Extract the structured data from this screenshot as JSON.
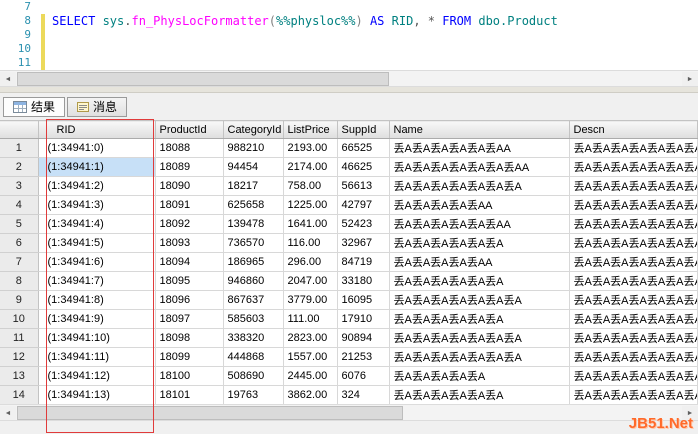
{
  "editor": {
    "line_numbers": [
      "7",
      "8",
      "9",
      "10",
      "11"
    ],
    "sql_tokens": [
      {
        "text": "SELECT ",
        "color": "#0000ff"
      },
      {
        "text": "sys",
        "color": "#008080"
      },
      {
        "text": ".",
        "color": "#555555"
      },
      {
        "text": "fn_PhysLocFormatter",
        "color": "#ff00ff"
      },
      {
        "text": "(",
        "color": "#808080"
      },
      {
        "text": "%%physloc%%",
        "color": "#008080"
      },
      {
        "text": ") ",
        "color": "#808080"
      },
      {
        "text": "AS",
        "color": "#0000ff"
      },
      {
        "text": " RID",
        "color": "#008080"
      },
      {
        "text": ", * ",
        "color": "#555555"
      },
      {
        "text": "FROM",
        "color": "#0000ff"
      },
      {
        "text": " dbo.Product",
        "color": "#008080"
      }
    ]
  },
  "tabs": {
    "results": "结果",
    "messages": "消息"
  },
  "grid": {
    "columns": [
      "RID",
      "ProductId",
      "CategoryId",
      "ListPrice",
      "SuppId",
      "Name",
      "Descn"
    ],
    "rows": [
      {
        "num": "1",
        "rid": "(1:34941:0)",
        "product_id": "18088",
        "category_id": "988210",
        "list_price": "2193.00",
        "supp_id": "66525",
        "name": "丢A丢A丢A丢A丢A丢AA",
        "descn": "丢A丢A丢A丢A丢A丢A丢A丢A丢A",
        "selected": false
      },
      {
        "num": "2",
        "rid": "(1:34941:1)",
        "product_id": "18089",
        "category_id": "94454",
        "list_price": "2174.00",
        "supp_id": "46625",
        "name": "丢A丢A丢A丢A丢A丢A丢AA",
        "descn": "丢A丢A丢A丢A丢A丢A丢A丢A丢A",
        "selected": true
      },
      {
        "num": "3",
        "rid": "(1:34941:2)",
        "product_id": "18090",
        "category_id": "18217",
        "list_price": "758.00",
        "supp_id": "56613",
        "name": "丢A丢A丢A丢A丢A丢A丢A",
        "descn": "丢A丢A丢A丢A丢A丢A丢A丢A丢A",
        "selected": false
      },
      {
        "num": "4",
        "rid": "(1:34941:3)",
        "product_id": "18091",
        "category_id": "625658",
        "list_price": "1225.00",
        "supp_id": "42797",
        "name": "丢A丢A丢A丢A丢AA",
        "descn": "丢A丢A丢A丢A丢A丢A丢A丢A丢A",
        "selected": false
      },
      {
        "num": "5",
        "rid": "(1:34941:4)",
        "product_id": "18092",
        "category_id": "139478",
        "list_price": "1641.00",
        "supp_id": "52423",
        "name": "丢A丢A丢A丢A丢A丢AA",
        "descn": "丢A丢A丢A丢A丢A丢A丢A丢A丢A",
        "selected": false
      },
      {
        "num": "6",
        "rid": "(1:34941:5)",
        "product_id": "18093",
        "category_id": "736570",
        "list_price": "116.00",
        "supp_id": "32967",
        "name": "丢A丢A丢A丢A丢A丢A",
        "descn": "丢A丢A丢A丢A丢A丢A丢A丢A丢A",
        "selected": false
      },
      {
        "num": "7",
        "rid": "(1:34941:6)",
        "product_id": "18094",
        "category_id": "186965",
        "list_price": "296.00",
        "supp_id": "84719",
        "name": "丢A丢A丢A丢A丢AA",
        "descn": "丢A丢A丢A丢A丢A丢A丢A丢A丢A",
        "selected": false
      },
      {
        "num": "8",
        "rid": "(1:34941:7)",
        "product_id": "18095",
        "category_id": "946860",
        "list_price": "2047.00",
        "supp_id": "33180",
        "name": "丢A丢A丢A丢A丢A丢A",
        "descn": "丢A丢A丢A丢A丢A丢A丢A丢A丢A",
        "selected": false
      },
      {
        "num": "9",
        "rid": "(1:34941:8)",
        "product_id": "18096",
        "category_id": "867637",
        "list_price": "3779.00",
        "supp_id": "16095",
        "name": "丢A丢A丢A丢A丢A丢A丢A",
        "descn": "丢A丢A丢A丢A丢A丢A丢A丢A丢A",
        "selected": false
      },
      {
        "num": "10",
        "rid": "(1:34941:9)",
        "product_id": "18097",
        "category_id": "585603",
        "list_price": "111.00",
        "supp_id": "17910",
        "name": "丢A丢A丢A丢A丢A丢A",
        "descn": "丢A丢A丢A丢A丢A丢A丢A丢A丢A",
        "selected": false
      },
      {
        "num": "11",
        "rid": "(1:34941:10)",
        "product_id": "18098",
        "category_id": "338320",
        "list_price": "2823.00",
        "supp_id": "90894",
        "name": "丢A丢A丢A丢A丢A丢A丢A",
        "descn": "丢A丢A丢A丢A丢A丢A丢A丢A丢A",
        "selected": false
      },
      {
        "num": "12",
        "rid": "(1:34941:11)",
        "product_id": "18099",
        "category_id": "444868",
        "list_price": "1557.00",
        "supp_id": "21253",
        "name": "丢A丢A丢A丢A丢A丢A丢A",
        "descn": "丢A丢A丢A丢A丢A丢A丢A丢A丢A",
        "selected": false
      },
      {
        "num": "13",
        "rid": "(1:34941:12)",
        "product_id": "18100",
        "category_id": "508690",
        "list_price": "2445.00",
        "supp_id": "6076",
        "name": "丢A丢A丢A丢A丢A",
        "descn": "丢A丢A丢A丢A丢A丢A丢A丢A丢A",
        "selected": false
      },
      {
        "num": "14",
        "rid": "(1:34941:13)",
        "product_id": "18101",
        "category_id": "19763",
        "list_price": "3862.00",
        "supp_id": "324",
        "name": "丢A丢A丢A丢A丢A丢A",
        "descn": "丢A丢A丢A丢A丢A丢A丢A丢A丢A",
        "selected": false
      }
    ]
  },
  "scrollbar": {
    "left_arrow": "◄",
    "right_arrow": "►"
  },
  "watermark": "JB51.Net",
  "colors": {
    "keyword_blue": "#0000ff",
    "function_magenta": "#ff00ff",
    "identifier_teal": "#008080",
    "line_number_blue": "#2b91af",
    "selection_bg": "#c7e0f7",
    "annotation_red": "#e03b3b",
    "watermark_orange": "#ff6a2a"
  }
}
